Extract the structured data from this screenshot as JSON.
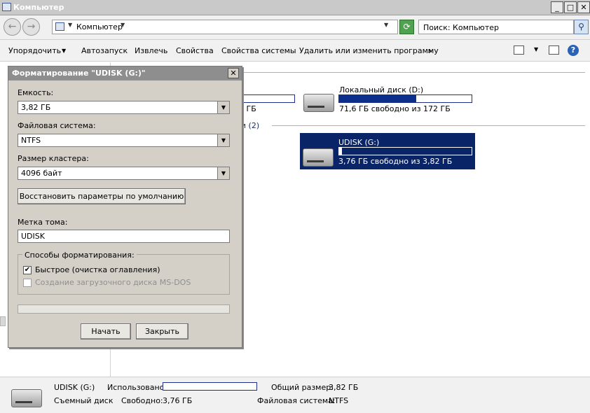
{
  "window": {
    "title": "Компьютер"
  },
  "address": {
    "path": "Компьютер",
    "search_placeholder": "Поиск: Компьютер"
  },
  "toolbar": {
    "items": [
      "Упорядочить",
      "Автозапуск",
      "Извлечь",
      "Свойства",
      "Свойства системы",
      "Удалить или изменить программу"
    ],
    "more": "»"
  },
  "content": {
    "group_removable": "ями (2)",
    "drive_c_free": "2 ГБ",
    "drive_d": {
      "name": "Локальный диск (D:)",
      "free": "71,6 ГБ свободно из 172 ГБ",
      "used_fraction": 0.58
    },
    "drive_g": {
      "name": "UDISK (G:)",
      "free": "3,76 ГБ свободно из 3,82 ГБ",
      "used_fraction": 0.02
    }
  },
  "status": {
    "name": "UDISK (G:)",
    "type": "Съемный диск",
    "used_label": "Использовано:",
    "free_label": "Свободно:",
    "free_value": "3,76 ГБ",
    "total_label": "Общий размер:",
    "total_value": "3,82 ГБ",
    "fs_label": "Файловая система:",
    "fs_value": "NTFS"
  },
  "dialog": {
    "title": "Форматирование \"UDISK (G:)\"",
    "capacity_label": "Емкость:",
    "capacity_value": "3,82 ГБ",
    "fs_label": "Файловая система:",
    "fs_value": "NTFS",
    "cluster_label": "Размер кластера:",
    "cluster_value": "4096 байт",
    "restore_button": "Восстановить параметры по умолчанию",
    "volume_label": "Метка тома:",
    "volume_value": "UDISK",
    "methods_label": "Способы форматирования:",
    "quick_label": "Быстрое (очистка оглавления)",
    "quick_checked": true,
    "msdos_label": "Создание загрузочного диска MS-DOS",
    "msdos_checked": false,
    "start_button": "Начать",
    "close_button": "Закрыть"
  },
  "colors": {
    "selection": "#0a2468",
    "bar_fill": "#0c2f8c"
  }
}
